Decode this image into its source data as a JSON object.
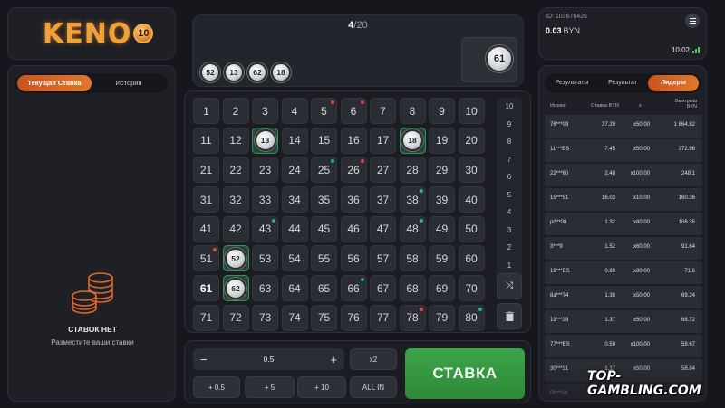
{
  "logo": {
    "text": "KENO",
    "badge": "10",
    "accent": "#f0a23a"
  },
  "bets_panel": {
    "tabs": [
      "Текущая Ставка",
      "История"
    ],
    "active_tab": 0,
    "empty_title": "СТАВОК НЕТ",
    "empty_subtitle": "Разместите ваши ставки"
  },
  "draw": {
    "count": "4",
    "total": "/20",
    "drawn_numbers": [
      "52",
      "13",
      "62",
      "18"
    ],
    "current_ball": "61"
  },
  "board": {
    "numbers": [
      "1",
      "2",
      "3",
      "4",
      "5",
      "6",
      "7",
      "8",
      "9",
      "10",
      "11",
      "12",
      "13",
      "14",
      "15",
      "16",
      "17",
      "18",
      "19",
      "20",
      "21",
      "22",
      "23",
      "24",
      "25",
      "26",
      "27",
      "28",
      "29",
      "30",
      "31",
      "32",
      "33",
      "34",
      "35",
      "36",
      "37",
      "38",
      "39",
      "40",
      "41",
      "42",
      "43",
      "44",
      "45",
      "46",
      "47",
      "48",
      "49",
      "50",
      "51",
      "52",
      "53",
      "54",
      "55",
      "56",
      "57",
      "58",
      "59",
      "60",
      "61",
      "62",
      "63",
      "64",
      "65",
      "66",
      "67",
      "68",
      "69",
      "70",
      "71",
      "72",
      "73",
      "74",
      "75",
      "76",
      "77",
      "78",
      "79",
      "80"
    ],
    "hit_numbers": [
      "13",
      "18",
      "52",
      "62"
    ],
    "bold_numbers": [
      "61"
    ],
    "red_dot_numbers": [
      "5",
      "6",
      "26",
      "51",
      "78"
    ],
    "teal_dot_numbers": [
      "25",
      "38",
      "43",
      "48",
      "66",
      "80"
    ],
    "scale": [
      "10",
      "9",
      "8",
      "7",
      "6",
      "5",
      "4",
      "3",
      "2",
      "1"
    ],
    "shuffle_icon": "⤨",
    "trash_icon": "🗑"
  },
  "bet": {
    "minus": "−",
    "stake": "0.5",
    "plus": "+",
    "x2": "x2",
    "quick": [
      "+ 0.5",
      "+ 5",
      "+ 10"
    ],
    "all_in": "ALL IN",
    "stavka": "СТАВКА",
    "green": "#3da449"
  },
  "account": {
    "id": "ID: 103676426",
    "balance": "0.03",
    "currency": "BYN",
    "time": "10:02"
  },
  "leaders": {
    "tabs": [
      "Результаты",
      "Результат",
      "Лидеры"
    ],
    "active_tab": 2,
    "headers": {
      "player": "Игроки",
      "bet": "Ставка  BYN",
      "mult": "x",
      "win": "Выигрыш BYN"
    },
    "rows": [
      {
        "p": "76***09",
        "b": "37.29",
        "m": "x50.00",
        "w": "1 864.82"
      },
      {
        "p": "11***ES",
        "b": "7.45",
        "m": "x50.00",
        "w": "372.96"
      },
      {
        "p": "22***60",
        "b": "2.48",
        "m": "x100.00",
        "w": "248.1"
      },
      {
        "p": "15***51",
        "b": "16.03",
        "m": "x10.00",
        "w": "160.36"
      },
      {
        "p": "pi***08",
        "b": "1.32",
        "m": "x80.00",
        "w": "106.35"
      },
      {
        "p": "3***9",
        "b": "1.52",
        "m": "x60.00",
        "w": "91.64"
      },
      {
        "p": "19***ES",
        "b": "0.89",
        "m": "x80.00",
        "w": "71.6"
      },
      {
        "p": "8a***74",
        "b": "1.38",
        "m": "x50.00",
        "w": "69.24"
      },
      {
        "p": "19***39",
        "b": "1.37",
        "m": "x50.00",
        "w": "68.72"
      },
      {
        "p": "77***ES",
        "b": "0.59",
        "m": "x100.00",
        "w": "59.67"
      },
      {
        "p": "30***31",
        "b": "1.17",
        "m": "x50.00",
        "w": "58.84"
      },
      {
        "p": "Pt***04",
        "b": "27.69",
        "m": "x2.00",
        "w": "55.39"
      }
    ]
  },
  "watermark": "TOP-GAMBLING.COM"
}
